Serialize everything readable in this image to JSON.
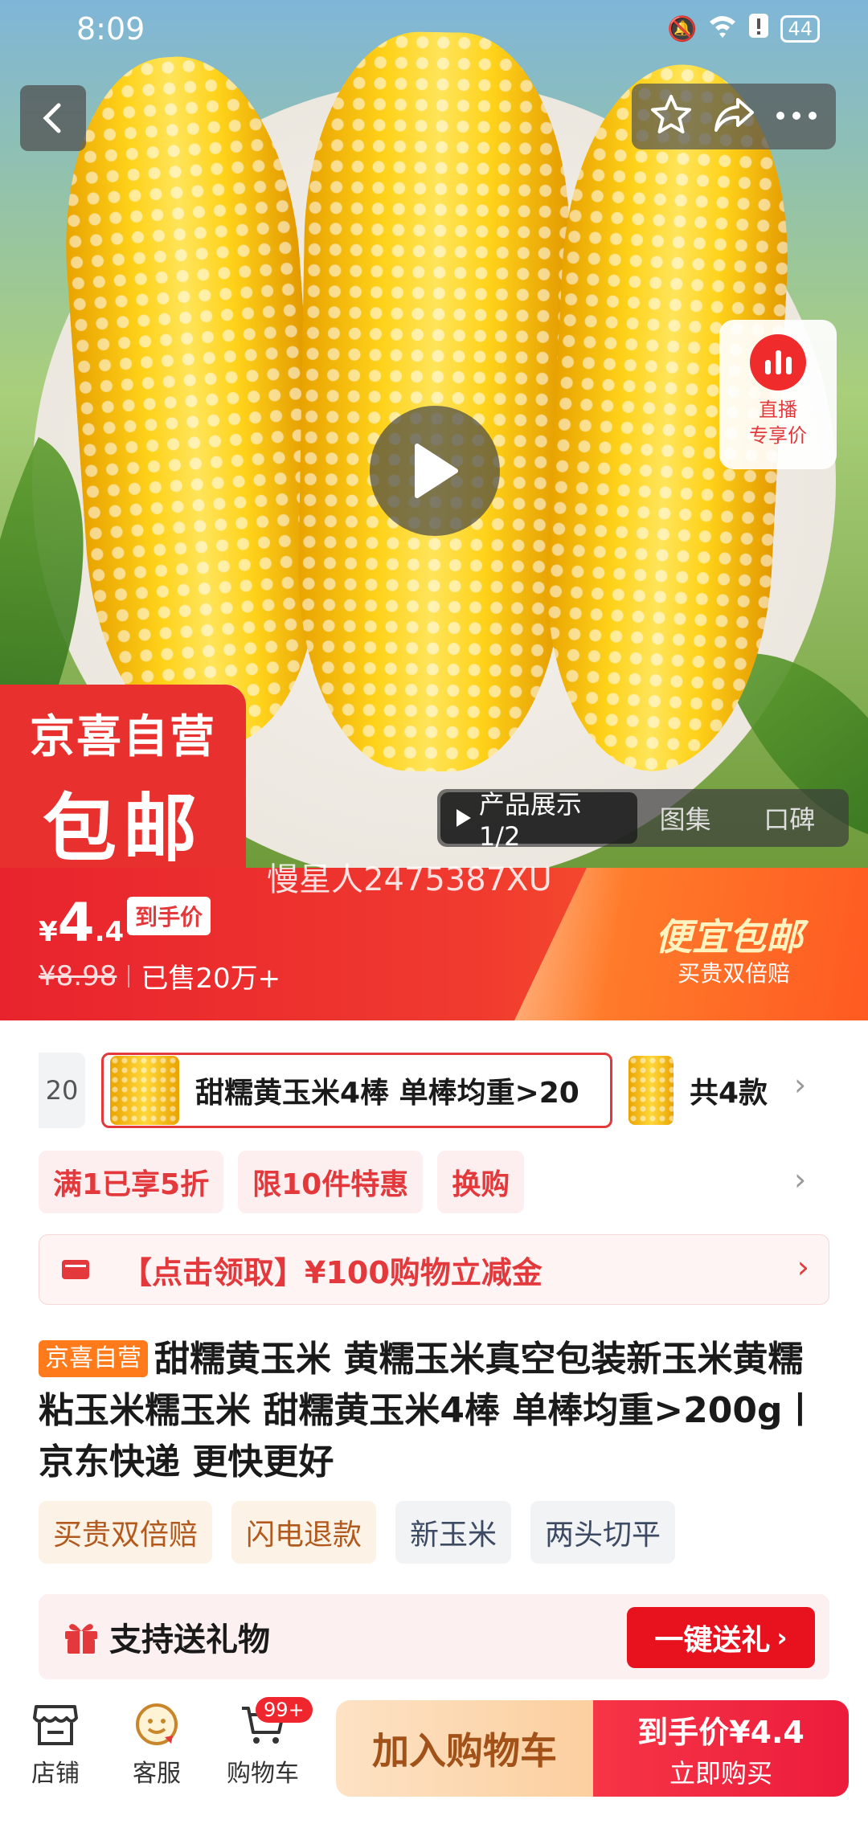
{
  "status_bar": {
    "time": "8:09",
    "battery": "44"
  },
  "hero": {
    "live_badge": {
      "line1": "直播",
      "line2": "专享价"
    },
    "store_badge": {
      "line1": "京喜自营",
      "line2": "包邮"
    },
    "media_tabs": [
      "产品展示1/2",
      "图集",
      "口碑"
    ]
  },
  "price": {
    "watermark": "慢星人2475387XU",
    "currency": "¥",
    "integer": "4",
    "decimal": ".4",
    "tag": "到手价",
    "original": "¥8.98",
    "sold": "已售20万+",
    "promo_title": "便宜包邮",
    "promo_sub": "买贵双倍赔"
  },
  "sku": {
    "prev_partial": "20",
    "selected": "甜糯黄玉米4棒 单棒均重>20",
    "count": "共4款"
  },
  "promos": [
    "满1已享5折",
    "限10件特惠",
    "换购"
  ],
  "coupon": {
    "text": "【点击领取】¥100购物立减金"
  },
  "title": {
    "tag": "京喜自营",
    "text": "甜糯黄玉米 黄糯玉米真空包装新玉米黄糯粘玉米糯玉米 甜糯黄玉米4棒 单棒均重>200g丨京东快递 更快更好"
  },
  "features": [
    "买贵双倍赔",
    "闪电退款",
    "新玉米",
    "两头切平"
  ],
  "gift": {
    "label": "支持送礼物",
    "button": "一键送礼"
  },
  "bottom_bar": {
    "shop": "店铺",
    "service": "客服",
    "cart": "购物车",
    "cart_badge": "99+",
    "add_cart": "加入购物车",
    "buy_line1": "到手价¥4.4",
    "buy_line2": "立即购买"
  },
  "colors": {
    "accent": "#e4393c",
    "self_tag": "#ff7a1a"
  }
}
